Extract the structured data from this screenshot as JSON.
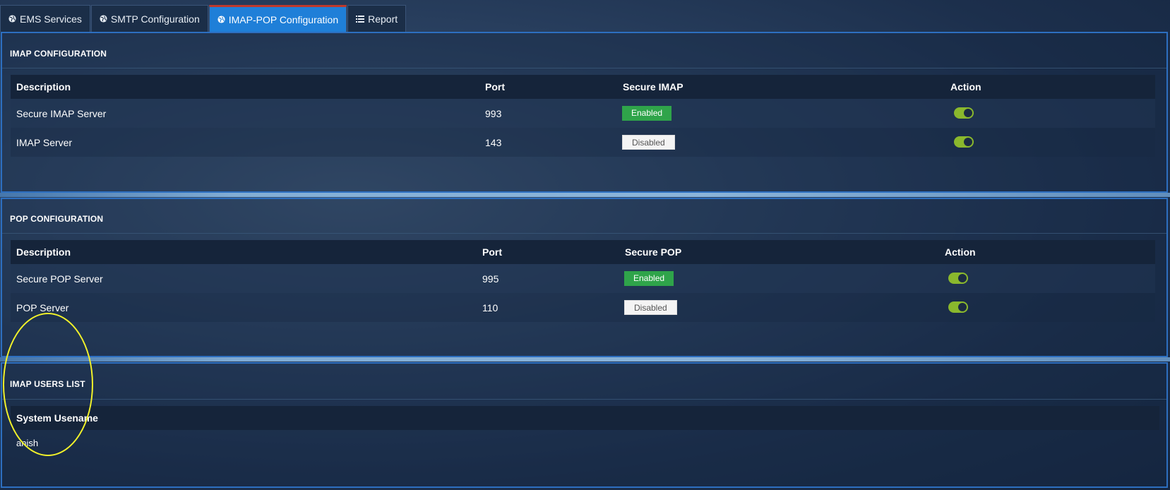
{
  "tabs": [
    {
      "label": "EMS Services",
      "icon": "globe-icon",
      "active": false
    },
    {
      "label": "SMTP Configuration",
      "icon": "globe-icon",
      "active": false
    },
    {
      "label": "IMAP-POP Configuration",
      "icon": "globe-icon",
      "active": true
    },
    {
      "label": "Report",
      "icon": "list-icon",
      "active": false
    }
  ],
  "imap": {
    "title": "IMAP CONFIGURATION",
    "headers": {
      "description": "Description",
      "port": "Port",
      "secure": "Secure IMAP",
      "action": "Action"
    },
    "rows": [
      {
        "description": "Secure IMAP Server",
        "port": "993",
        "secure": "Enabled",
        "action_on": true
      },
      {
        "description": "IMAP Server",
        "port": "143",
        "secure": "Disabled",
        "action_on": true
      }
    ]
  },
  "pop": {
    "title": "POP CONFIGURATION",
    "headers": {
      "description": "Description",
      "port": "Port",
      "secure": "Secure POP",
      "action": "Action"
    },
    "rows": [
      {
        "description": "Secure POP Server",
        "port": "995",
        "secure": "Enabled",
        "action_on": true
      },
      {
        "description": "POP Server",
        "port": "110",
        "secure": "Disabled",
        "action_on": true
      }
    ]
  },
  "users": {
    "title": "IMAP USERS LIST",
    "header": "System Usename",
    "rows": [
      "anish"
    ]
  },
  "colors": {
    "accent": "#1f7fd8",
    "enabled": "#2fa44a",
    "toggle": "#8ab82d",
    "highlight": "#f2f22a"
  }
}
